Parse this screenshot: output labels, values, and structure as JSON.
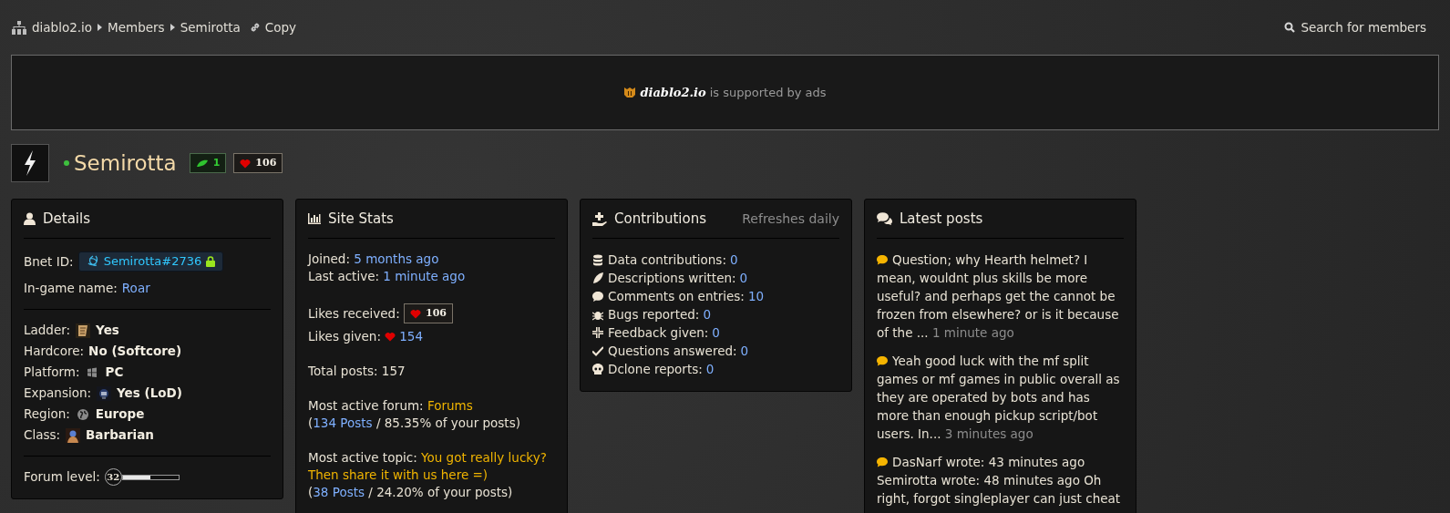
{
  "breadcrumb": {
    "items": [
      {
        "label": "diablo2.io"
      },
      {
        "label": "Members"
      },
      {
        "label": "Semirotta"
      }
    ],
    "copy_link": "Copy",
    "search_link": "Search for members"
  },
  "ad_banner": {
    "brand": "diablo2.io",
    "text": "is supported by ads"
  },
  "profile": {
    "username": "Semirotta",
    "online": true,
    "badges": [
      {
        "kind": "contribution",
        "value": "1"
      },
      {
        "kind": "likes",
        "value": "106"
      }
    ]
  },
  "details": {
    "title": "Details",
    "sections": [
      [
        {
          "kind": "bnet",
          "label": "Bnet ID:",
          "value": "Semirotta#2736"
        },
        {
          "kind": "link",
          "label": "In-game name:",
          "value": "Roar"
        }
      ],
      [
        {
          "kind": "icon",
          "label": "Ladder:",
          "value": "Yes"
        },
        {
          "kind": "plain",
          "label": "Hardcore:",
          "value": "No (Softcore)"
        },
        {
          "kind": "icon",
          "label": "Platform:",
          "value": "PC"
        },
        {
          "kind": "icon",
          "label": "Expansion:",
          "value": "Yes (LoD)"
        },
        {
          "kind": "icon",
          "label": "Region:",
          "value": "Europe"
        },
        {
          "kind": "icon",
          "label": "Class:",
          "value": "Barbarian"
        }
      ],
      [
        {
          "kind": "level",
          "label": "Forum level:",
          "value": "32",
          "level": 0.5
        }
      ]
    ]
  },
  "site_stats": {
    "title": "Site Stats",
    "paragraphs": [
      [
        [
          {
            "kind": "plain",
            "text": "Joined: "
          },
          {
            "kind": "link",
            "text": "5 months ago"
          }
        ],
        [
          {
            "kind": "plain",
            "text": "Last active: "
          },
          {
            "kind": "link",
            "text": "1 minute ago"
          }
        ]
      ],
      [
        [
          {
            "kind": "plain",
            "text": "Likes received: "
          },
          {
            "kind": "badge",
            "text": "106"
          }
        ],
        [
          {
            "kind": "plain",
            "text": "Likes given: "
          },
          {
            "kind": "heart",
            "text": "154"
          }
        ]
      ],
      [
        [
          {
            "kind": "plain",
            "text": "Total posts: 157"
          }
        ]
      ],
      [
        [
          {
            "kind": "plain",
            "text": "Most active forum: "
          },
          {
            "kind": "topic",
            "text": "Forums"
          }
        ],
        [
          {
            "kind": "plain",
            "text": "("
          },
          {
            "kind": "link",
            "text": "134 Posts"
          },
          {
            "kind": "plain",
            "text": " / 85.35% of your posts)"
          }
        ]
      ],
      [
        [
          {
            "kind": "plain",
            "text": "Most active topic: "
          },
          {
            "kind": "topic",
            "text": "You got really lucky? Then share it with us here =)"
          }
        ],
        [
          {
            "kind": "plain",
            "text": "("
          },
          {
            "kind": "link",
            "text": "38 Posts"
          },
          {
            "kind": "plain",
            "text": " / 24.20% of your posts)"
          }
        ]
      ]
    ]
  },
  "contributions": {
    "title": "Contributions",
    "note": "Refreshes daily",
    "items": [
      {
        "label": "Data contributions:",
        "value": "0"
      },
      {
        "label": "Descriptions written:",
        "value": "0"
      },
      {
        "label": "Comments on entries:",
        "value": "10"
      },
      {
        "label": "Bugs reported:",
        "value": "0"
      },
      {
        "label": "Feedback given:",
        "value": "0"
      },
      {
        "label": "Questions answered:",
        "value": "0"
      },
      {
        "label": "Dclone reports:",
        "value": "0"
      }
    ]
  },
  "latest_posts": {
    "title": "Latest posts",
    "items": [
      {
        "text": "Question; why Hearth helmet? I mean, wouldnt plus skills be more useful? and perhaps get the cannot be frozen from elsewhere? or is it because of the ...",
        "time": "1 minute ago"
      },
      {
        "text": "Yeah good luck with the mf split games or mf games in public overall as they are operated by bots and has more than enough pickup script/bot users. In...",
        "time": "3 minutes ago"
      },
      {
        "text": "DasNarf wrote: 43 minutes ago Semirotta wrote: 48 minutes ago Oh right, forgot singleplayer can just cheat"
      }
    ]
  }
}
